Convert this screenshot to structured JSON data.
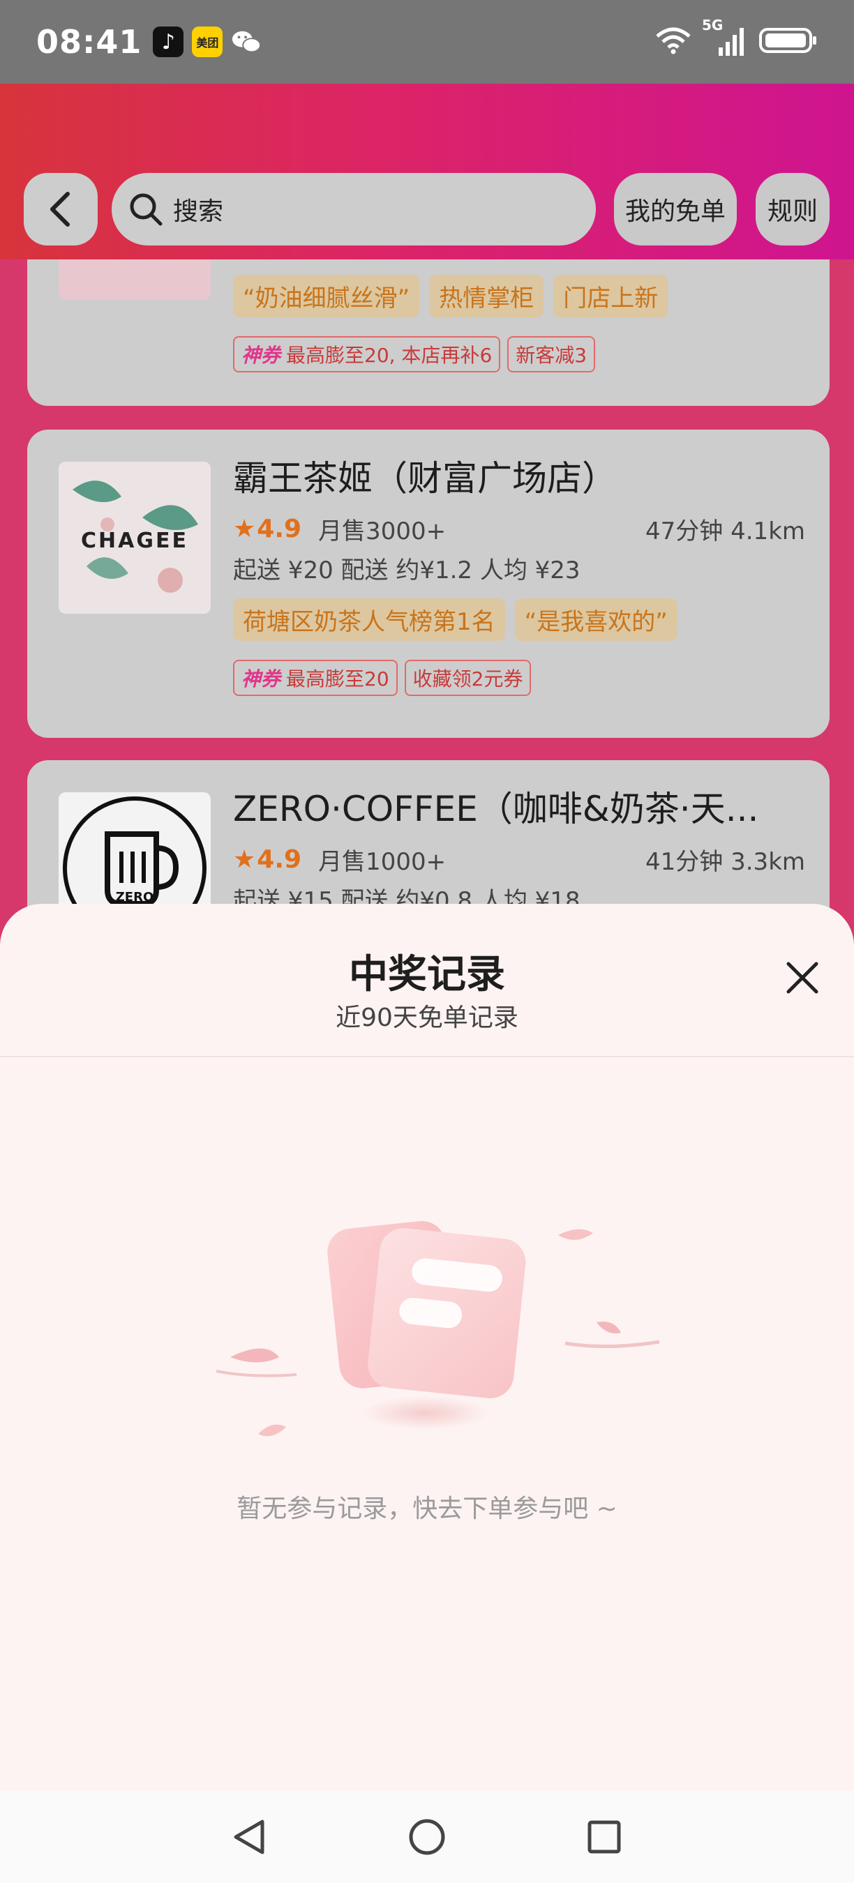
{
  "status_bar": {
    "time": "08:41",
    "signal_label": "5G",
    "app_icons": [
      "tiktok-icon",
      "meituan-icon",
      "wechat-icon"
    ],
    "meituan_label": "美团"
  },
  "header": {
    "search_placeholder": "搜索",
    "my_free_label": "我的免单",
    "rules_label": "规则"
  },
  "stores": [
    {
      "tags": [
        "“奶油细腻丝滑”",
        "热情掌柜",
        "门店上新"
      ],
      "promos": [
        {
          "brand": "神券",
          "text": "最高膨至20, 本店再补6"
        },
        {
          "text": "新客减3"
        }
      ]
    },
    {
      "name": "霸王茶姬（财富广场店）",
      "logo_text": "CHAGEE",
      "rating": "4.9",
      "monthly_sales": "月售3000+",
      "distance": "47分钟 4.1km",
      "fees": "起送 ¥20 配送 约¥1.2 人均 ¥23",
      "tags": [
        "荷塘区奶茶人气榜第1名",
        "“是我喜欢的”"
      ],
      "promos": [
        {
          "brand": "神券",
          "text": "最高膨至20"
        },
        {
          "text": "收藏领2元券"
        }
      ]
    },
    {
      "name": "ZERO·COFFEE（咖啡&奶茶·天...",
      "logo_text": "ZERO",
      "rating": "4.9",
      "monthly_sales": "月售1000+",
      "distance": "41分钟 3.3km",
      "fees": "起送 ¥15 配送 约¥0.8 人均 ¥18"
    }
  ],
  "modal": {
    "title": "中奖记录",
    "subtitle": "近90天免单记录",
    "empty_text": "暂无参与记录，快去下单参与吧 ~"
  },
  "colors": {
    "header_start": "#d7343c",
    "header_end": "#cf1490",
    "rating": "#e1701b",
    "tag_text": "#c9741a",
    "modal_bg": "#fdf3f2"
  }
}
